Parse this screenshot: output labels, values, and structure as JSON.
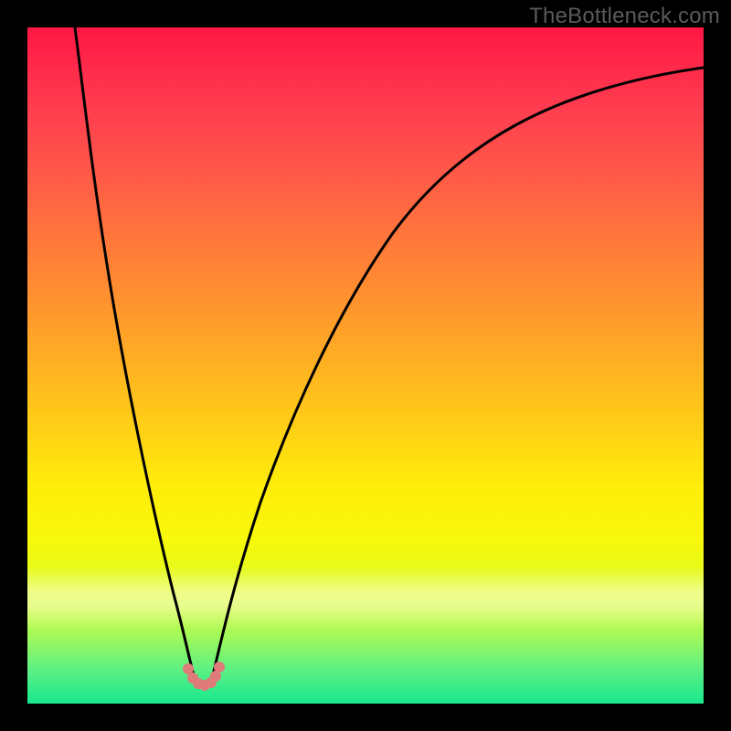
{
  "watermark": {
    "text": "TheBottleneck.com"
  },
  "chart_data": {
    "type": "line",
    "title": "",
    "xlabel": "",
    "ylabel": "",
    "xlim": [
      0,
      100
    ],
    "ylim": [
      0,
      100
    ],
    "grid": false,
    "legend": false,
    "background_gradient_stops": [
      {
        "pos": 0.0,
        "color": "#ff1744"
      },
      {
        "pos": 0.12,
        "color": "#ff3d4f"
      },
      {
        "pos": 0.28,
        "color": "#ff6d3f"
      },
      {
        "pos": 0.44,
        "color": "#ff9e2a"
      },
      {
        "pos": 0.6,
        "color": "#ffd215"
      },
      {
        "pos": 0.76,
        "color": "#f7f90a"
      },
      {
        "pos": 0.9,
        "color": "#a3f95a"
      },
      {
        "pos": 1.0,
        "color": "#17e88d"
      }
    ],
    "pale_highlight_band_y": [
      80,
      90
    ],
    "series": [
      {
        "name": "left-curve",
        "color": "#000000",
        "x": [
          7,
          8,
          9,
          10,
          12,
          14,
          16,
          18,
          20,
          22,
          23,
          24,
          25
        ],
        "values": [
          100,
          90,
          80,
          70,
          57,
          45,
          34,
          24,
          15,
          8,
          6,
          5,
          4
        ]
      },
      {
        "name": "right-curve",
        "color": "#000000",
        "x": [
          27,
          28,
          30,
          33,
          37,
          42,
          48,
          55,
          63,
          72,
          82,
          92,
          100
        ],
        "values": [
          4,
          6,
          10,
          18,
          30,
          43,
          56,
          67,
          76,
          83,
          88,
          92,
          94
        ]
      },
      {
        "name": "minimum-marker",
        "color": "#e57373",
        "type": "scatter-blob",
        "x": [
          23.5,
          24.5,
          25.5,
          26.5,
          27.5,
          25.0,
          26.0
        ],
        "values": [
          5.0,
          4.0,
          3.5,
          4.0,
          5.0,
          3.3,
          3.3
        ]
      }
    ],
    "minimum_point": {
      "x": 25.5,
      "value": 3.3
    }
  }
}
